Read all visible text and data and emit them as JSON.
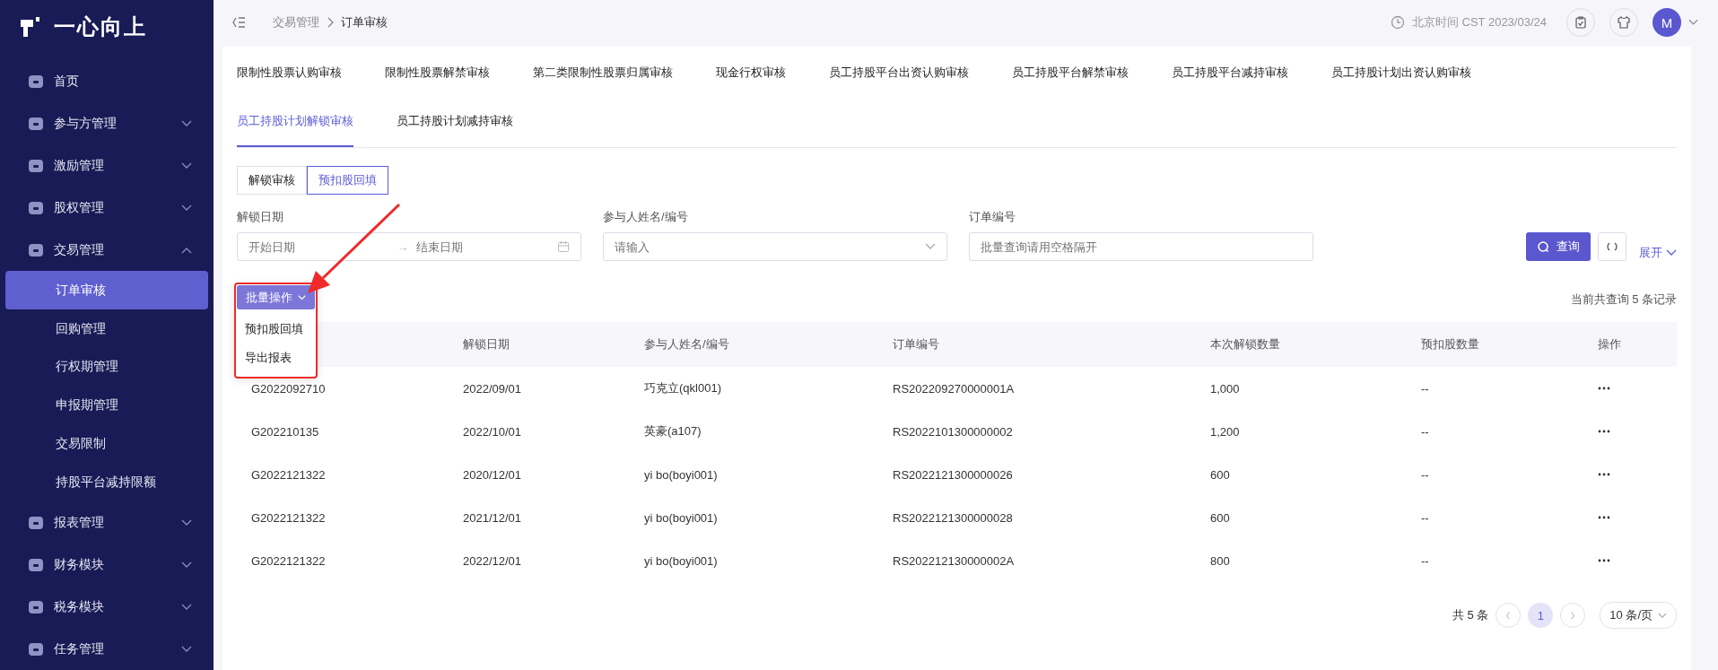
{
  "logo": {
    "text": "一心向上"
  },
  "sidebar": {
    "items": [
      {
        "label": "首页",
        "kind": "link"
      },
      {
        "label": "参与方管理",
        "kind": "group",
        "expanded": false
      },
      {
        "label": "激励管理",
        "kind": "group",
        "expanded": false
      },
      {
        "label": "股权管理",
        "kind": "group",
        "expanded": false
      },
      {
        "label": "交易管理",
        "kind": "group",
        "expanded": true,
        "children": [
          {
            "label": "订单审核",
            "selected": true
          },
          {
            "label": "回购管理",
            "selected": false
          },
          {
            "label": "行权期管理",
            "selected": false
          },
          {
            "label": "申报期管理",
            "selected": false
          },
          {
            "label": "交易限制",
            "selected": false
          },
          {
            "label": "持股平台减持限额",
            "selected": false
          }
        ]
      },
      {
        "label": "报表管理",
        "kind": "group",
        "expanded": false
      },
      {
        "label": "财务模块",
        "kind": "group",
        "expanded": false
      },
      {
        "label": "税务模块",
        "kind": "group",
        "expanded": false
      },
      {
        "label": "任务管理",
        "kind": "group",
        "expanded": false
      }
    ]
  },
  "header": {
    "breadcrumb": [
      "交易管理",
      "订单审核"
    ],
    "time": "北京时间 CST 2023/03/24",
    "avatar": "M"
  },
  "tab_rows": [
    [
      {
        "label": "限制性股票认购审核",
        "selected": false
      },
      {
        "label": "限制性股票解禁审核",
        "selected": false
      },
      {
        "label": "第二类限制性股票归属审核",
        "selected": false
      },
      {
        "label": "现金行权审核",
        "selected": false
      },
      {
        "label": "员工持股平台出资认购审核",
        "selected": false
      },
      {
        "label": "员工持股平台解禁审核",
        "selected": false
      },
      {
        "label": "员工持股平台减持审核",
        "selected": false
      },
      {
        "label": "员工持股计划出资认购审核",
        "selected": false
      }
    ],
    [
      {
        "label": "员工持股计划解锁审核",
        "selected": true
      },
      {
        "label": "员工持股计划减持审核",
        "selected": false
      }
    ]
  ],
  "segments": [
    {
      "label": "解锁审核",
      "selected": false
    },
    {
      "label": "预扣股回填",
      "selected": true
    }
  ],
  "filters": {
    "date": {
      "label": "解锁日期",
      "start_placeholder": "开始日期",
      "separator": "→",
      "end_placeholder": "结束日期"
    },
    "participant": {
      "label": "参与人姓名/编号",
      "placeholder": "请输入"
    },
    "order": {
      "label": "订单编号",
      "placeholder": "批量查询请用空格隔开"
    },
    "query_button": "查询",
    "expand_link": "展开"
  },
  "batch": {
    "label": "批量操作",
    "open": true,
    "menu": [
      "预扣股回填",
      "导出报表"
    ]
  },
  "record_count": "当前共查询 5 条记录",
  "table": {
    "columns": [
      "",
      "解锁日期",
      "参与人姓名/编号",
      "订单编号",
      "本次解锁数量",
      "预扣股数量",
      "操作"
    ],
    "rows": [
      [
        "G2022092710",
        "2022/09/01",
        "巧克立(qkl001)",
        "RS202209270000001A",
        "1,000",
        "--"
      ],
      [
        "G202210135",
        "2022/10/01",
        "英豪(a107)",
        "RS2022101300000002",
        "1,200",
        "--"
      ],
      [
        "G2022121322",
        "2020/12/01",
        "yi bo(boyi001)",
        "RS2022121300000026",
        "600",
        "--"
      ],
      [
        "G2022121322",
        "2021/12/01",
        "yi bo(boyi001)",
        "RS2022121300000028",
        "600",
        "--"
      ],
      [
        "G2022121322",
        "2022/12/01",
        "yi bo(boyi001)",
        "RS202212130000002A",
        "800",
        "--"
      ]
    ]
  },
  "pagination": {
    "total": "共 5 条",
    "pages": [
      {
        "label": "1",
        "selected": true
      }
    ],
    "page_size": "10 条/页"
  }
}
